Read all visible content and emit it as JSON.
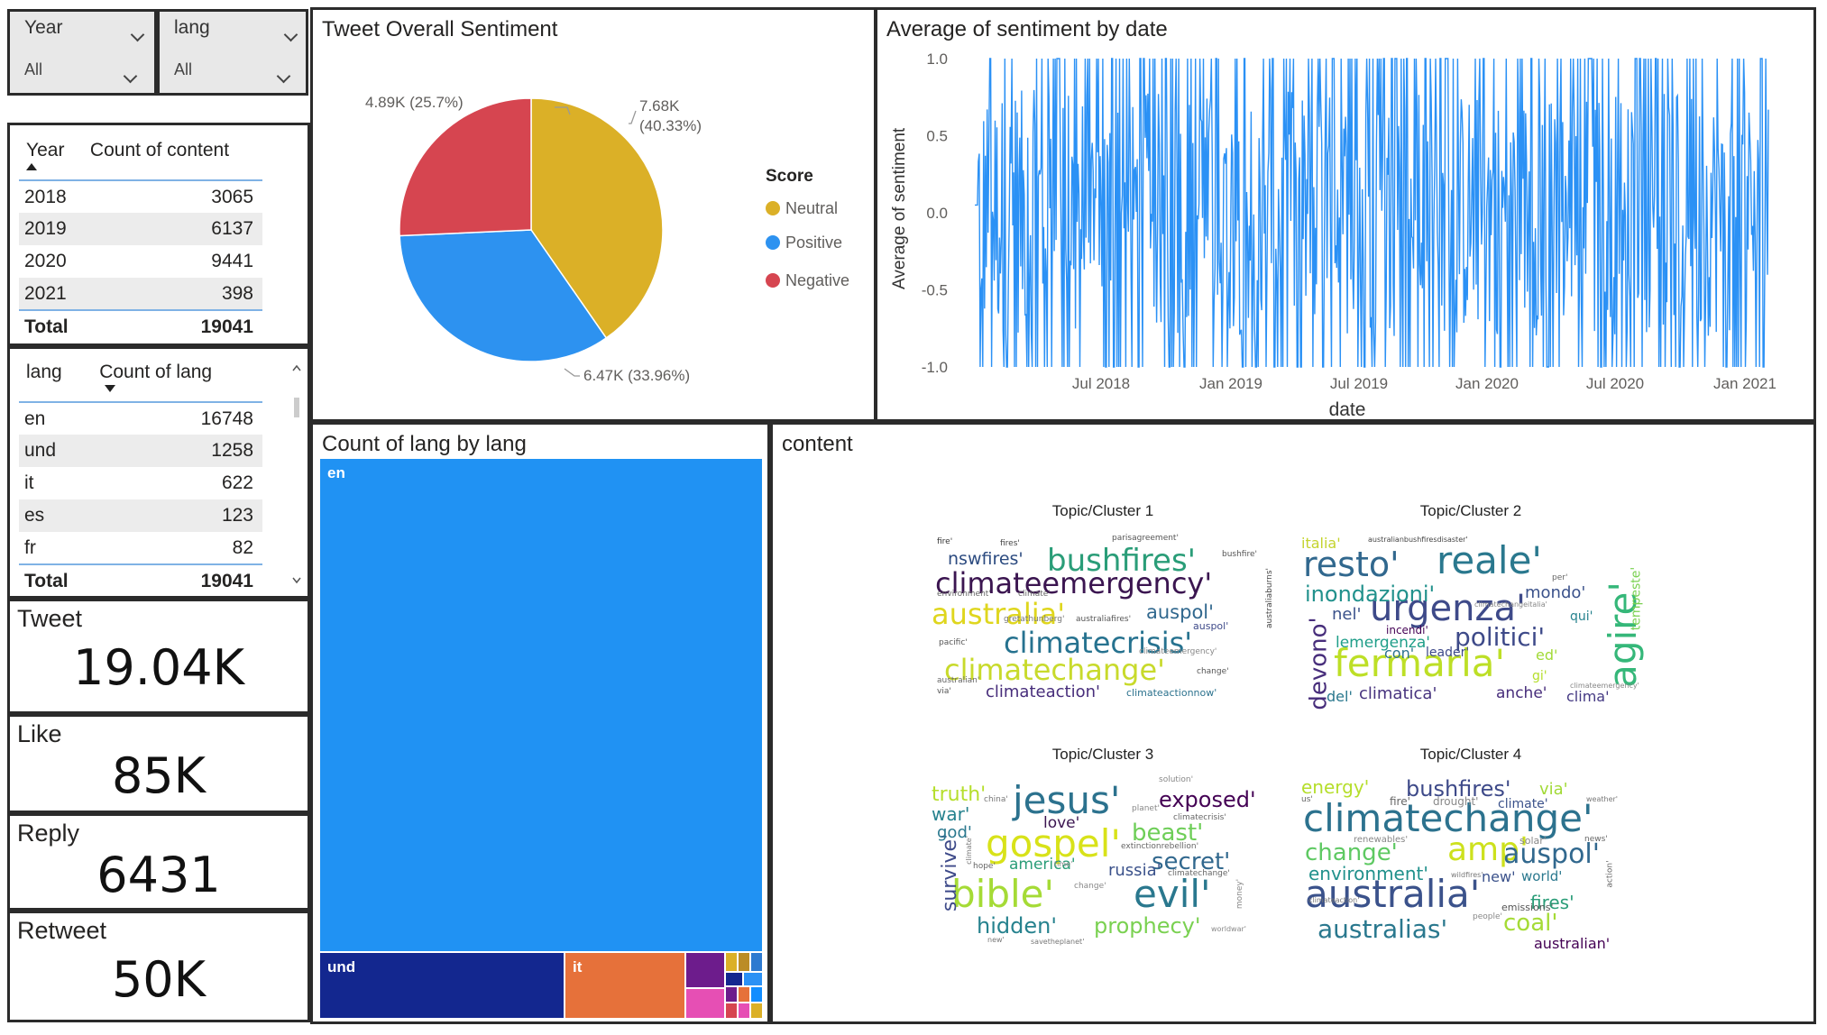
{
  "slicers": {
    "year": {
      "label": "Year",
      "value": "All"
    },
    "lang": {
      "label": "lang",
      "value": "All"
    }
  },
  "year_table": {
    "headers": [
      "Year",
      "Count of content"
    ],
    "rows": [
      {
        "year": "2018",
        "count": "3065"
      },
      {
        "year": "2019",
        "count": "6137"
      },
      {
        "year": "2020",
        "count": "9441"
      },
      {
        "year": "2021",
        "count": "398"
      }
    ],
    "total_label": "Total",
    "total_value": "19041"
  },
  "lang_table": {
    "headers": [
      "lang",
      "Count of lang"
    ],
    "rows": [
      {
        "lang": "en",
        "count": "16748"
      },
      {
        "lang": "und",
        "count": "1258"
      },
      {
        "lang": "it",
        "count": "622"
      },
      {
        "lang": "es",
        "count": "123"
      },
      {
        "lang": "fr",
        "count": "82"
      }
    ],
    "total_label": "Total",
    "total_value": "19041"
  },
  "cards": {
    "tweet": {
      "label": "Tweet",
      "value": "19.04K"
    },
    "like": {
      "label": "Like",
      "value": "85K"
    },
    "reply": {
      "label": "Reply",
      "value": "6431"
    },
    "retweet": {
      "label": "Retweet",
      "value": "50K"
    }
  },
  "sentiment_pie": {
    "title": "Tweet Overall Sentiment",
    "legend_title": "Score",
    "labels": {
      "neutral": [
        "7.68K",
        "(40.33%)"
      ],
      "positive": "6.47K (33.96%)",
      "negative": "4.89K (25.7%)"
    }
  },
  "sentiment_line": {
    "title": "Average of sentiment by date",
    "xlabel": "date",
    "ylabel": "Average of sentiment",
    "yticks": [
      "1.0",
      "0.5",
      "0.0",
      "-0.5",
      "-1.0"
    ],
    "xticks": [
      "Jul 2018",
      "Jan 2019",
      "Jul 2019",
      "Jan 2020",
      "Jul 2020",
      "Jan 2021"
    ]
  },
  "treemap": {
    "title": "Count of lang by lang",
    "labels": {
      "en": "en",
      "und": "und",
      "it": "it"
    }
  },
  "content": {
    "title": "content",
    "clusters": [
      {
        "title": "Topic/Cluster 1",
        "words": [
          "bushfires'",
          "climateemergency'",
          "australia'",
          "climatecrisis'",
          "climatechange'",
          "auspol'",
          "nswfires'",
          "climateaction'",
          "climateactionnow'",
          "fire'",
          "fires'",
          "parisagreement'",
          "bushfire'",
          "climate'",
          "environment'",
          "australiafires'",
          "australiaburns'",
          "pacific'",
          "change'",
          "via'",
          "australian'",
          "auspol'",
          "climateemergency'",
          "gretathunberg'"
        ]
      },
      {
        "title": "Topic/Cluster 2",
        "words": [
          "resto'",
          "reale'",
          "urgenza'",
          "fermarla'",
          "agire'",
          "politici'",
          "inondazioni'",
          "devono'",
          "lemergenza'",
          "mondo'",
          "italia'",
          "climatica'",
          "incendi'",
          "nel'",
          "con'",
          "leader'",
          "anche'",
          "del'",
          "clima'",
          "tempeste'",
          "qui'",
          "gi'",
          "ed'",
          "australianbushfiresdisaster'",
          "climatechangeitalia'",
          "climateemergency'",
          "per'"
        ]
      },
      {
        "title": "Topic/Cluster 3",
        "words": [
          "jesus'",
          "gospel'",
          "bible'",
          "evil'",
          "exposed'",
          "beast'",
          "secret'",
          "survive'",
          "truth'",
          "war'",
          "god'",
          "love'",
          "america'",
          "russia'",
          "hidden'",
          "prophecy'",
          "solution'",
          "china'",
          "planet'",
          "climatecrisis'",
          "extinctionrebellion'",
          "hope'",
          "change'",
          "climatechange'",
          "money'",
          "worldwar'",
          "time'",
          "savetheplanet'",
          "new'",
          "climate'"
        ]
      },
      {
        "title": "Topic/Cluster 4",
        "words": [
          "climatechange'",
          "australia'",
          "amp'",
          "auspol'",
          "bushfires'",
          "change'",
          "environment'",
          "australias'",
          "coal'",
          "fires'",
          "energy'",
          "via'",
          "fire'",
          "drought'",
          "climate'",
          "renewables'",
          "solar'",
          "new'",
          "world'",
          "emissions'",
          "people'",
          "australian'",
          "news'",
          "action'",
          "weather'",
          "wildfires'",
          "climateaction'",
          "us'"
        ]
      }
    ]
  },
  "colors": {
    "neutral": "#dbb027",
    "positive": "#2d92f0",
    "negative": "#d64550",
    "line": "#2b91f5",
    "treemap_en": "#2092f3",
    "treemap_und": "#13278f",
    "treemap_it": "#e6713a",
    "treemap_purple": "#6d1c8c",
    "treemap_pink": "#e64fb4"
  }
}
